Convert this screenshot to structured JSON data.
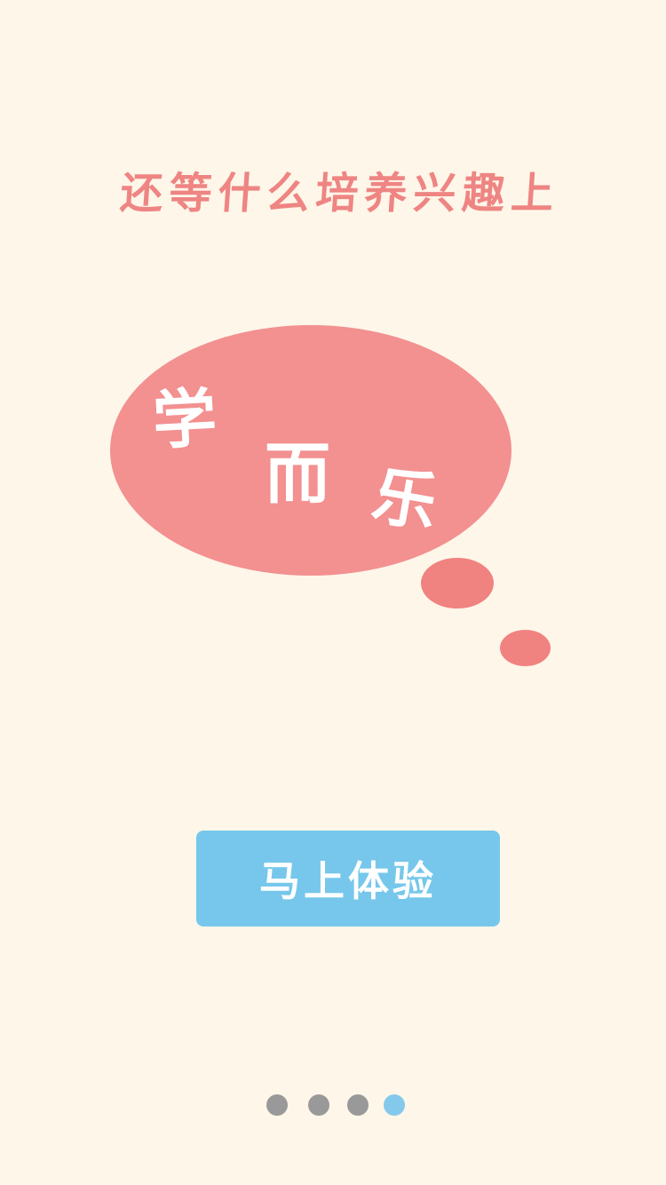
{
  "headline": "还等什么培养兴趣上",
  "bubble": {
    "chars": [
      "学",
      "而",
      "乐"
    ]
  },
  "cta_button": {
    "label": "马上体验"
  },
  "pager": {
    "total_pages": 4,
    "current_page": 4,
    "active_color": "#84C9EC",
    "inactive_color": "#999999"
  },
  "colors": {
    "background": "#FEF6E9",
    "headline": "#EE8583",
    "bubble_main": "#F39090",
    "bubble_small": "#F08280",
    "button": "#76C7EB"
  }
}
